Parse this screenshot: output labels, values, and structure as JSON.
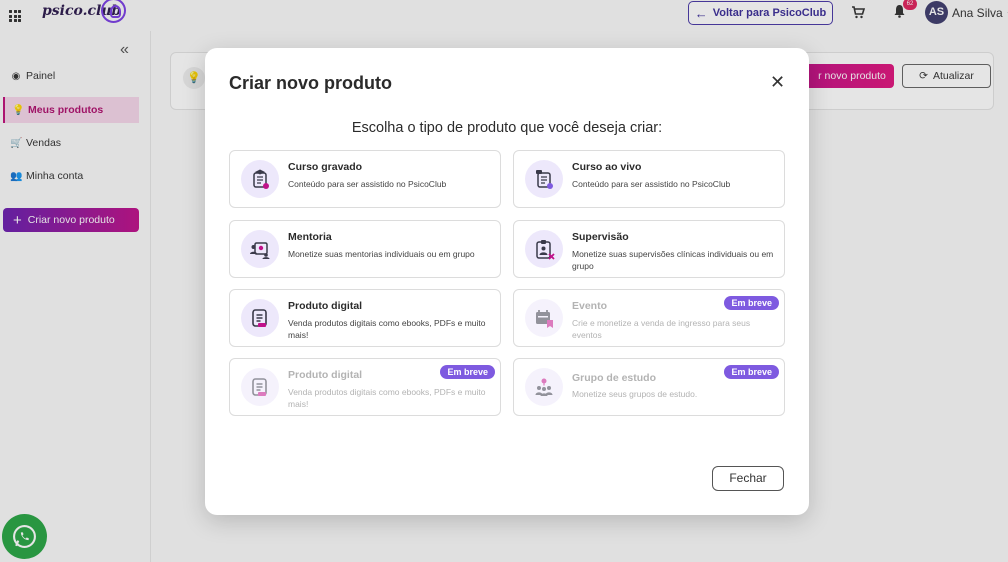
{
  "topbar": {
    "logo_text": "psico.club",
    "back_button": "Voltar para PsicoClub",
    "notifications_count": "62",
    "avatar_initials": "AS",
    "user_name": "Ana Silva"
  },
  "sidebar": {
    "items": [
      {
        "label": "Painel",
        "icon": "dashboard-icon"
      },
      {
        "label": "Meus produtos",
        "icon": "bulb-icon"
      },
      {
        "label": "Vendas",
        "icon": "cart-icon"
      },
      {
        "label": "Minha conta",
        "icon": "users-icon"
      }
    ],
    "create_button": "Criar novo produto"
  },
  "main": {
    "new_product_button": "r novo produto",
    "refresh_button": "Atualizar"
  },
  "modal": {
    "title": "Criar novo produto",
    "subtitle": "Escolha o tipo de produto que você deseja criar:",
    "close_button": "Fechar",
    "options": [
      {
        "title": "Curso gravado",
        "description": "Conteúdo para ser assistido no PsicoClub",
        "badge": "",
        "enabled": true,
        "icon": "recorded-course-icon"
      },
      {
        "title": "Curso ao vivo",
        "description": "Conteúdo para ser assistido no PsicoClub",
        "badge": "",
        "enabled": true,
        "icon": "live-course-icon"
      },
      {
        "title": "Mentoria",
        "description": "Monetize suas mentorias individuais ou em grupo",
        "badge": "",
        "enabled": true,
        "icon": "mentoring-icon"
      },
      {
        "title": "Supervisão",
        "description": "Monetize suas supervisões clínicas individuais ou em grupo",
        "badge": "",
        "enabled": true,
        "icon": "supervision-icon"
      },
      {
        "title": "Produto digital",
        "description": "Venda produtos digitais como ebooks, PDFs e muito mais!",
        "badge": "",
        "enabled": true,
        "icon": "digital-product-icon"
      },
      {
        "title": "Evento",
        "description": "Crie e monetize a venda de ingresso para seus eventos",
        "badge": "Em breve",
        "enabled": false,
        "icon": "event-icon"
      },
      {
        "title": "Produto digital",
        "description": "Venda produtos digitais como ebooks, PDFs e muito mais!",
        "badge": "Em breve",
        "enabled": false,
        "icon": "digital-product-icon"
      },
      {
        "title": "Grupo de estudo",
        "description": "Monetize seus grupos de estudo.",
        "badge": "Em breve",
        "enabled": false,
        "icon": "study-group-icon"
      }
    ]
  },
  "colors": {
    "accent_purple": "#7e5ae0",
    "accent_pink": "#c0118a",
    "whatsapp_green": "#2aa545"
  }
}
